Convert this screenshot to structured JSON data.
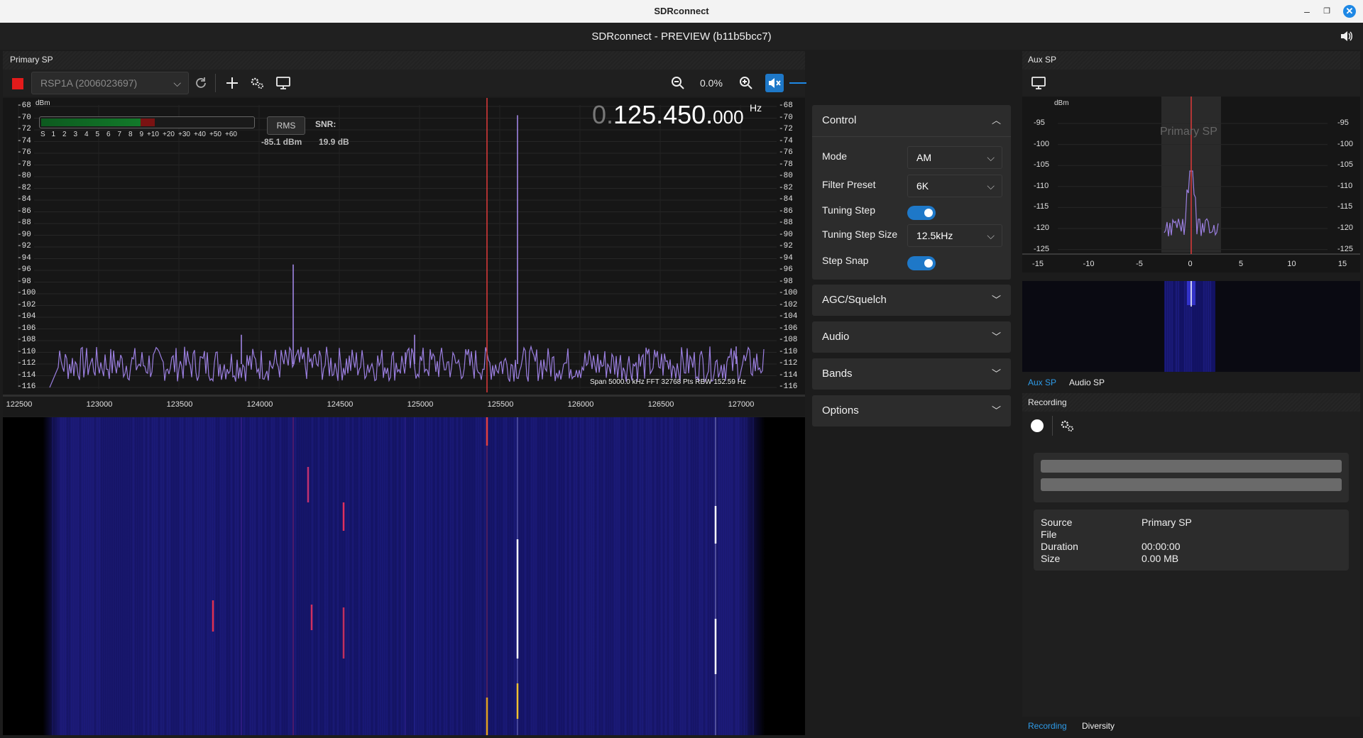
{
  "os": {
    "title": "SDRconnect"
  },
  "app": {
    "title": "SDRconnect - PREVIEW (b11b5bcc7)"
  },
  "primary": {
    "panel_title": "Primary SP",
    "device": "RSP1A (2006023697)",
    "zoom": "0.0%",
    "frequency_prefix": "0.",
    "frequency_main": "125.450.",
    "frequency_suffix": "000",
    "frequency_unit": "Hz",
    "dbm_label": "dBm",
    "smeter_scale": [
      "S",
      "1",
      "2",
      "3",
      "4",
      "5",
      "6",
      "7",
      "8",
      "9",
      "+10",
      "+20",
      "+30",
      "+40",
      "+50",
      "+60"
    ],
    "rms_label": "RMS",
    "snr_label": "SNR:",
    "level_value": "-85.1 dBm",
    "snr_value": "19.9 dB",
    "span_info": "Span 5000.0 kHz  FFT 32768 Pts  RBW 152.59 Hz",
    "y_ticks": [
      "-68",
      "-70",
      "-72",
      "-74",
      "-76",
      "-78",
      "-80",
      "-82",
      "-84",
      "-86",
      "-88",
      "-90",
      "-92",
      "-94",
      "-96",
      "-98",
      "-100",
      "-102",
      "-104",
      "-106",
      "-108",
      "-110",
      "-112",
      "-114",
      "-116"
    ],
    "x_ticks": [
      "122500",
      "123000",
      "123500",
      "124000",
      "124500",
      "125000",
      "125500",
      "126000",
      "126500",
      "127000"
    ]
  },
  "control": {
    "title": "Control",
    "mode_label": "Mode",
    "mode_value": "AM",
    "filter_label": "Filter Preset",
    "filter_value": "6K",
    "tuning_step_label": "Tuning Step",
    "tuning_step_on": true,
    "step_size_label": "Tuning Step Size",
    "step_size_value": "12.5kHz",
    "step_snap_label": "Step Snap",
    "step_snap_on": true,
    "sections": [
      "AGC/Squelch",
      "Audio",
      "Bands",
      "Options"
    ]
  },
  "aux": {
    "panel_title": "Aux SP",
    "dbm_label": "dBm",
    "watermark": "Primary SP",
    "y_left": [
      "-95",
      "-100",
      "-105",
      "-110",
      "-115",
      "-120",
      "-125"
    ],
    "y_right": [
      "-95",
      "-100",
      "-105",
      "-110",
      "-115",
      "-120",
      "-125"
    ],
    "x_ticks": [
      "-15",
      "-10",
      "-5",
      "0",
      "5",
      "10",
      "15"
    ],
    "tab_active": "Aux SP",
    "tab_other": "Audio SP"
  },
  "recording": {
    "panel_title": "Recording",
    "rows": [
      {
        "k": "Source",
        "v": "Primary SP"
      },
      {
        "k": "File",
        "v": ""
      },
      {
        "k": "Duration",
        "v": "00:00:00"
      },
      {
        "k": "Size",
        "v": "0.00 MB"
      }
    ],
    "tab_active": "Recording",
    "tab_other": "Diversity"
  },
  "colors": {
    "accent": "#1e78c8",
    "trace": "#9b7fe0",
    "marker": "#e03a3a",
    "waterfall_bg": "#0d0d5c"
  },
  "icons": [
    "stop-icon",
    "refresh-icon",
    "add-icon",
    "settings-icon",
    "display-icon",
    "zoom-out-icon",
    "zoom-in-icon",
    "mute-icon",
    "spectrum-icon",
    "histogram-icon",
    "layout-icon",
    "more-icon",
    "record-icon",
    "speaker-icon"
  ]
}
